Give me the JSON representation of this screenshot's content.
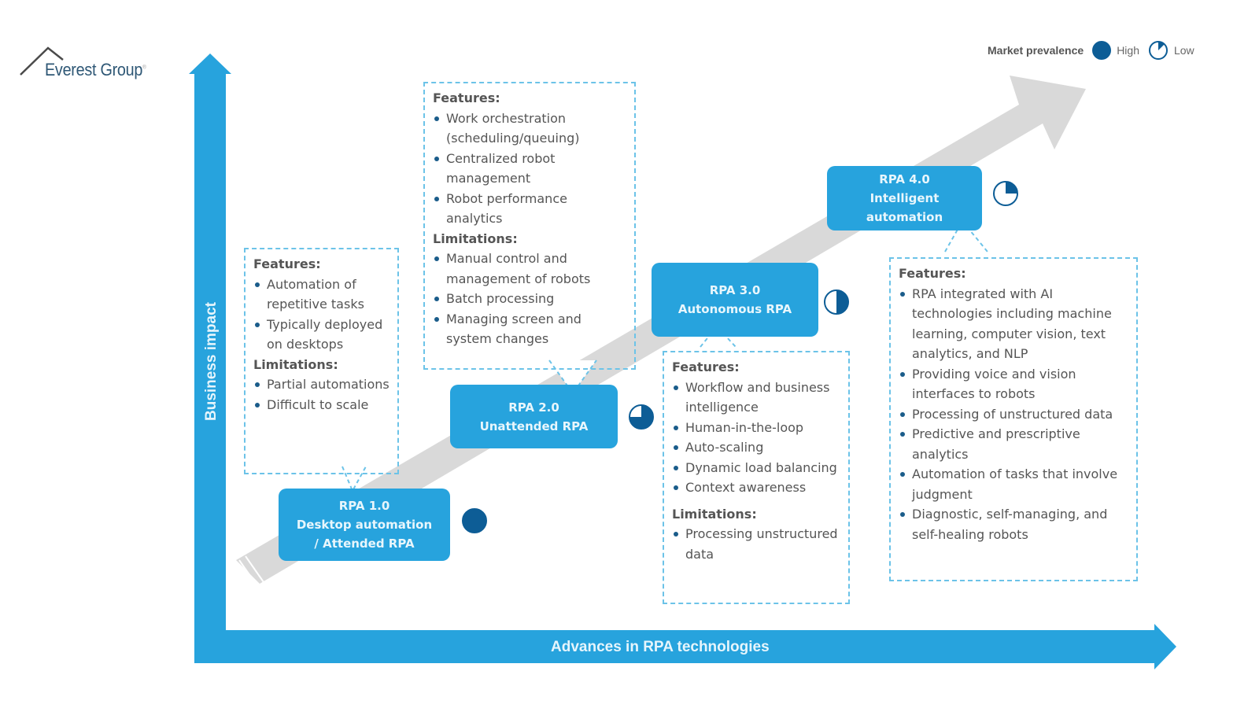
{
  "logo": {
    "text": "Everest Group",
    "mark": "®"
  },
  "legend": {
    "title": "Market prevalence",
    "high_label": "High",
    "low_label": "Low",
    "high_color": "#0d5d96",
    "low_color": "#0d5d96"
  },
  "axes": {
    "y_label": "Business impact",
    "x_label": "Advances in RPA technologies",
    "color": "#27a3dd"
  },
  "trend_arrow_color": "#d9d9d9",
  "stages": [
    {
      "id": "rpa1",
      "lines": [
        "RPA 1.0",
        "Desktop automation",
        "/ Attended RPA"
      ],
      "prevalence": 1.0,
      "features_header": "Features:",
      "features": [
        "Automation of repetitive tasks",
        "Typically deployed on desktops"
      ],
      "limitations_header": "Limitations:",
      "limitations": [
        "Partial automations",
        "Difficult to scale"
      ]
    },
    {
      "id": "rpa2",
      "lines": [
        "RPA 2.0",
        "Unattended RPA"
      ],
      "prevalence": 0.75,
      "features_header": "Features:",
      "features": [
        "Work orchestration (scheduling/queuing)",
        "Centralized robot management",
        "Robot performance analytics"
      ],
      "limitations_header": "Limitations:",
      "limitations": [
        "Manual control and management of robots",
        "Batch processing",
        "Managing screen and system changes"
      ]
    },
    {
      "id": "rpa3",
      "lines": [
        "RPA 3.0",
        "Autonomous RPA"
      ],
      "prevalence": 0.5,
      "features_header": "Features:",
      "features": [
        "Workflow and business intelligence",
        "Human-in-the-loop",
        "Auto-scaling",
        "Dynamic load balancing",
        "Context awareness"
      ],
      "limitations_header": "Limitations:",
      "limitations": [
        "Processing unstructured data"
      ]
    },
    {
      "id": "rpa4",
      "lines": [
        "RPA 4.0",
        "Intelligent",
        "automation"
      ],
      "prevalence": 0.25,
      "features_header": "Features:",
      "features": [
        "RPA integrated with AI technologies including machine learning, computer vision, text analytics, and NLP",
        "Providing voice and vision interfaces to robots",
        "Processing of unstructured data",
        "Predictive and prescriptive analytics",
        "Automation of tasks that involve judgment",
        "Diagnostic, self-managing, and self-healing robots"
      ],
      "limitations_header": "",
      "limitations": []
    }
  ]
}
